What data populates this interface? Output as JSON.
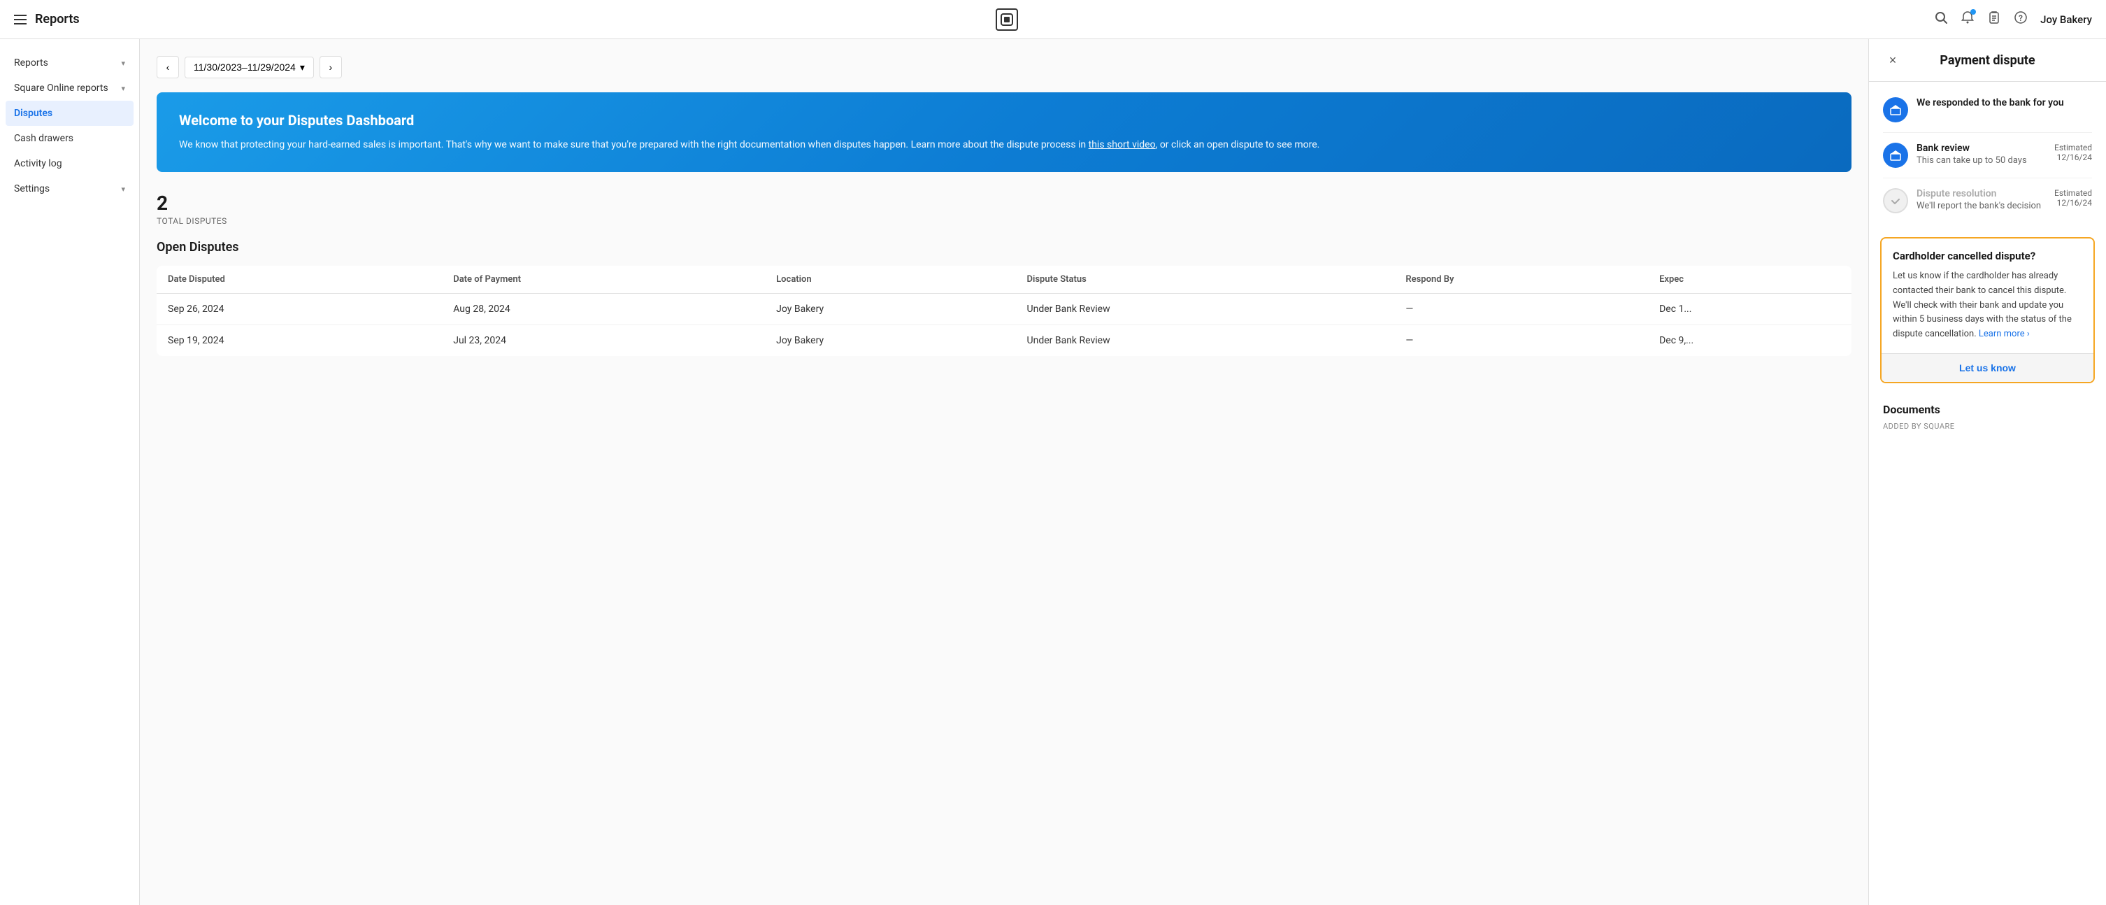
{
  "header": {
    "menu_icon": "☰",
    "title": "Reports",
    "logo_text": "▢",
    "search_icon": "🔍",
    "notification_icon": "🔔",
    "clipboard_icon": "📋",
    "help_icon": "?",
    "business_name": "Joy Bakery"
  },
  "sidebar": {
    "items": [
      {
        "id": "reports",
        "label": "Reports",
        "chevron": "▾",
        "active": false
      },
      {
        "id": "square-online",
        "label": "Square Online reports",
        "chevron": "▾",
        "active": false
      },
      {
        "id": "disputes",
        "label": "Disputes",
        "active": true
      },
      {
        "id": "cash-drawers",
        "label": "Cash drawers",
        "active": false
      },
      {
        "id": "activity-log",
        "label": "Activity log",
        "active": false
      },
      {
        "id": "settings",
        "label": "Settings",
        "chevron": "▾",
        "active": false
      }
    ]
  },
  "date_range": {
    "display": "11/30/2023–11/29/2024",
    "prev_icon": "‹",
    "next_icon": "›",
    "chevron": "▾"
  },
  "welcome_banner": {
    "title": "Welcome to your Disputes Dashboard",
    "description": "We know that protecting your hard-earned sales is important. That's why we want to make sure that you're prepared with the right documentation when disputes happen. Learn more about the dispute process in ",
    "link_text": "this short video",
    "description_end": ", or click an open dispute to see more."
  },
  "disputes_summary": {
    "total_count": "2",
    "total_label": "TOTAL DISPUTES",
    "section_title": "Open Disputes"
  },
  "table": {
    "headers": [
      "Date Disputed",
      "Date of Payment",
      "Location",
      "Dispute Status",
      "Respond By",
      "Expec"
    ],
    "rows": [
      {
        "date_disputed": "Sep 26, 2024",
        "date_payment": "Aug 28, 2024",
        "location": "Joy Bakery",
        "status": "Under Bank Review",
        "respond_by": "—",
        "expected": "Dec 1..."
      },
      {
        "date_disputed": "Sep 19, 2024",
        "date_payment": "Jul 23, 2024",
        "location": "Joy Bakery",
        "status": "Under Bank Review",
        "respond_by": "—",
        "expected": "Dec 9,..."
      }
    ]
  },
  "right_panel": {
    "title": "Payment dispute",
    "close_icon": "×",
    "timeline": [
      {
        "icon": "bank",
        "icon_type": "blue",
        "title": "We responded to the bank for you",
        "subtitle": "",
        "date": ""
      },
      {
        "icon": "🏛",
        "icon_type": "blue",
        "title": "Bank review",
        "subtitle": "This can take up to 50 days",
        "date_label": "Estimated",
        "date": "12/16/24"
      },
      {
        "icon": "✓",
        "icon_type": "gray",
        "title": "Dispute resolution",
        "subtitle": "We'll report the bank's decision",
        "date_label": "Estimated",
        "date": "12/16/24"
      }
    ],
    "cancelled_box": {
      "title": "Cardholder cancelled dispute?",
      "text": "Let us know if the cardholder has already contacted their bank to cancel this dispute. We'll check with their bank and update you within 5 business days with the status of the dispute cancellation. ",
      "learn_more": "Learn more ›",
      "button_label": "Let us know"
    },
    "documents": {
      "title": "Documents",
      "added_by": "ADDED BY SQUARE"
    }
  }
}
